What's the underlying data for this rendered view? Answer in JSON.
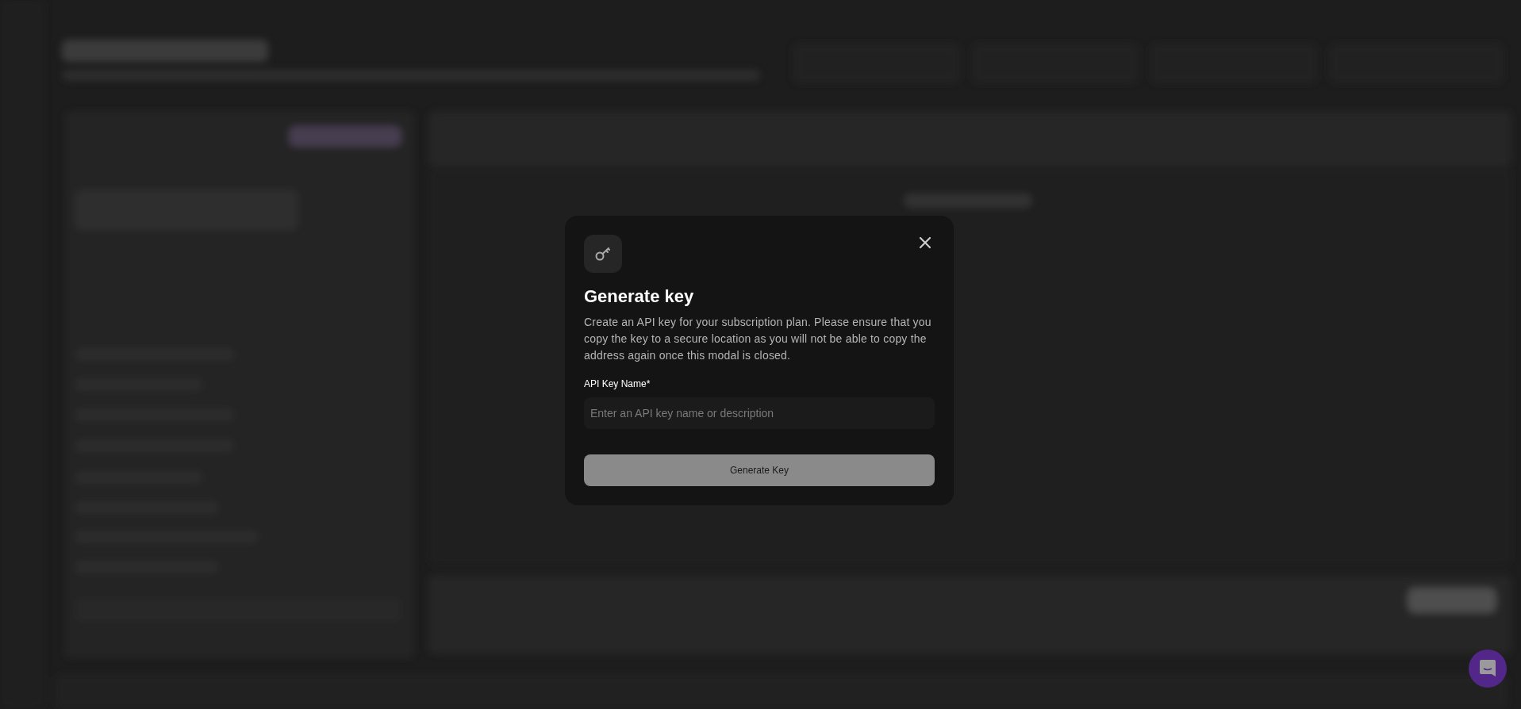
{
  "modal": {
    "title": "Generate key",
    "description": "Create an API key for your subscription plan. Please ensure that you copy the key to a secure location as you will not be able to copy the address again once this modal is closed.",
    "field": {
      "label": "API Key Name*",
      "placeholder": "Enter an API key name or description"
    },
    "button": {
      "label": "Generate Key",
      "disabled": true
    }
  }
}
